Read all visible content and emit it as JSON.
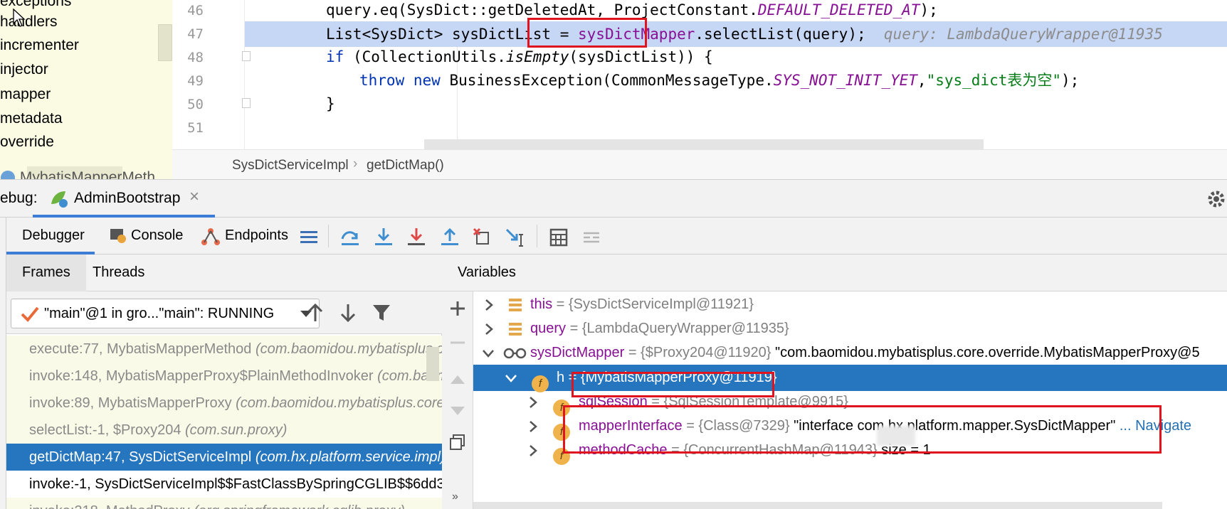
{
  "project_tree": {
    "items": [
      "exceptions",
      "handlers",
      "incrementer",
      "injector",
      "mapper",
      "metadata",
      "override"
    ],
    "last_item": "MybatisMapperMeth"
  },
  "editor": {
    "lines": [
      {
        "num": "46",
        "code_a": "query.eq(SysDict::getDeletedAt, ProjectConstant.",
        "code_b": "DEFAULT_DELETED_AT",
        "code_c": ");"
      },
      {
        "num": "47",
        "code_a": "List<SysDict> sysDictList = ",
        "code_b": "sysDictMapper",
        "code_c": ".selectList(query);",
        "hint": "query: LambdaQueryWrapper@11935"
      },
      {
        "num": "48",
        "kw": "if",
        "code_a": " (CollectionUtils.",
        "code_b": "isEmpty",
        "code_c": "(sysDictList)) {"
      },
      {
        "num": "49",
        "kw1": "throw",
        "kw2": "new",
        "code_a": " BusinessException(CommonMessageType.",
        "code_b": "SYS_NOT_INIT_YET",
        "code_c": ",",
        "str": "\"sys_dict表为空\"",
        "code_d": ");"
      },
      {
        "num": "50",
        "code_a": "}"
      },
      {
        "num": "51",
        "code_a": ""
      }
    ],
    "breadcrumb": [
      "SysDictServiceImpl",
      "getDictMap()"
    ]
  },
  "debug": {
    "label": "ebug:",
    "run_tab": "AdminBootstrap",
    "tabs": [
      "Debugger",
      "Console",
      "Endpoints"
    ],
    "panel_tabs": [
      "Frames",
      "Threads"
    ],
    "variables_label": "Variables",
    "thread": "\"main\"@1 in gro...\"main\": RUNNING",
    "frames": [
      {
        "method": "execute:77, MybatisMapperMethod ",
        "pkg": "(com.baomidou.mybatisplus.core.override)"
      },
      {
        "method": "invoke:148, MybatisMapperProxy$PlainMethodInvoker ",
        "pkg": "(com.baomidou.mybatisplus)"
      },
      {
        "method": "invoke:89, MybatisMapperProxy ",
        "pkg": "(com.baomidou.mybatisplus.core.override)"
      },
      {
        "method": "selectList:-1, $Proxy204 ",
        "pkg": "(com.sun.proxy)"
      },
      {
        "method": "getDictMap:47, SysDictServiceImpl ",
        "pkg": "(com.hx.platform.service.impl)"
      },
      {
        "method": "invoke:-1, SysDictServiceImpl$$FastClassBySpringCGLIB$$6dd3",
        "pkg": ""
      },
      {
        "method": "invoke:218, MethodProxy ",
        "pkg": "(org.springframework.cglib.proxy)"
      }
    ],
    "variables": [
      {
        "name": "this",
        "value": " = {SysDictServiceImpl@11921}"
      },
      {
        "name": "query",
        "value": " = {LambdaQueryWrapper@11935}"
      },
      {
        "name": "sysDictMapper",
        "value": " = {$Proxy204@11920} ",
        "str": "\"com.baomidou.mybatisplus.core.override.MybatisMapperProxy@5"
      },
      {
        "name": "h",
        "value": " = {MybatisMapperProxy@11919}"
      },
      {
        "name": "sqlSession",
        "value": " = {SqlSessionTemplate@9915}"
      },
      {
        "name": "mapperInterface",
        "value": " = {Class@7329} ",
        "str": "\"interface com.hx.platform.mapper.SysDictMapper\"",
        "link": " ... Navigate"
      },
      {
        "name": "methodCache",
        "value": " = {ConcurrentHashMap@11943}",
        "extra": "  size = 1"
      }
    ],
    "badge": "f"
  },
  "colors": {
    "accent": "#2675bf",
    "highlight": "#c6d6f5",
    "annotation": "#e0141e"
  }
}
